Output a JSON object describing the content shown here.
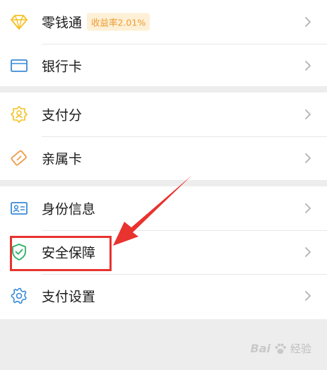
{
  "menu": {
    "lingqiantong": {
      "label": "零钱通",
      "badge": "收益率2.01%"
    },
    "bank_card": {
      "label": "银行卡"
    },
    "pay_score": {
      "label": "支付分"
    },
    "family_card": {
      "label": "亲属卡"
    },
    "identity": {
      "label": "身份信息"
    },
    "security": {
      "label": "安全保障"
    },
    "pay_settings": {
      "label": "支付设置"
    }
  },
  "icons": {
    "lingqiantong": "diamond-icon",
    "bank_card": "card-icon",
    "pay_score": "score-badge-icon",
    "family_card": "family-card-icon",
    "identity": "id-card-icon",
    "security": "shield-check-icon",
    "pay_settings": "gear-icon",
    "chevron": "chevron-right-icon"
  },
  "colors": {
    "diamond": "#f5c122",
    "bank_card": "#3a8bd8",
    "pay_score": "#f5c122",
    "family_card": "#ef9a47",
    "identity": "#3a8bd8",
    "security": "#2aae67",
    "pay_settings": "#3a8bd8",
    "badge_bg": "#fdf0d6",
    "badge_text": "#ef9b32",
    "annotation": "#e8332f"
  },
  "watermark": {
    "brand": "Bai",
    "suffix": "经验"
  }
}
